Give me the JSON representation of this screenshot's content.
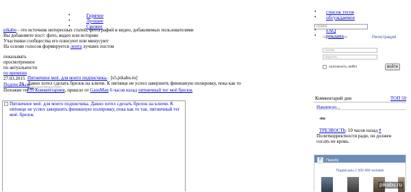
{
  "nav": {
    "items": [
      "Горячее",
      "Лучшее",
      "Свежее"
    ]
  },
  "right_links": {
    "items": [
      "список тегов",
      "обсуждаемое",
      "FAQ",
      "реклама"
    ]
  },
  "search": {
    "placeholder": "поиск"
  },
  "login": {
    "tab_auth": "Авторизация",
    "tab_register": "Регистрация",
    "login_placeholder": "логин",
    "password_placeholder": "пароль",
    "remember_label": "запомнить меня",
    "remember_help": "?",
    "submit_label": "войти"
  },
  "intro": {
    "brand_link": "pikabu",
    "line1_rest": " - это источник интересных статей, фотографий и видео, добавляемых пользователями",
    "line2": "Вы добавляете пост: фото, видео или историю",
    "line3": "Участники сообщества его плюсуют или минусуют",
    "line4_before": "На основе голосов формируется ",
    "line4_link": "лента",
    "line4_after": " лучших постов"
  },
  "sort": {
    "label": "показывать",
    "options": [
      "просмотренное",
      "по актуальности"
    ],
    "by_time": "по времени"
  },
  "post": {
    "date": "27.03.2015",
    "rating": "71",
    "buttons_fragment": "Подписаться",
    "share_label": "Похожие тег",
    "title_link": "Пятничное моё. для моего подписчика.",
    "title_suffix": " [s5.pikabu.ru]",
    "description_line1": "Давно хотел сделать брелок на ключи. К пятнице не успел завершить финишную полировку, пока как то",
    "description_line2": "так.",
    "comments_link": "135 Комментариев",
    "posted_from": ", пришло от ",
    "author": "GansMan",
    "time_ago": " 6 часов назад",
    "tags": "пятничный тег моё брелок",
    "ghost_save": "Сохранить",
    "ghost_report": "подробнее",
    "image_alt": "Пятничное моё. для моего подписчика. Давно хотел сделать брелок на ключи. К пятнице не успел завершить финишную полировку, пока как то так. пятничный тег моё. брелок"
  },
  "comments_day": {
    "title": "Комментарий дня",
    "top_link": "ТОП 50",
    "author_link": "Накипело...",
    "rating_badge": "-ms",
    "user_link": "TPE3BOCTb",
    "time_ago": ": 10 часов назад",
    "reply_link": "#",
    "text_line1": "Политкорректности ради, он должен",
    "text_line2": "сосать не кровь."
  },
  "vk": {
    "icon_label": "П",
    "title": "Пикабу",
    "subscribers": "Подписаны 1 500 499 человек"
  },
  "watermark": "pikabu.ru",
  "colors": {
    "link": "#0000cc",
    "vk_header": "#6b8db6",
    "vk_text": "#45688e"
  }
}
